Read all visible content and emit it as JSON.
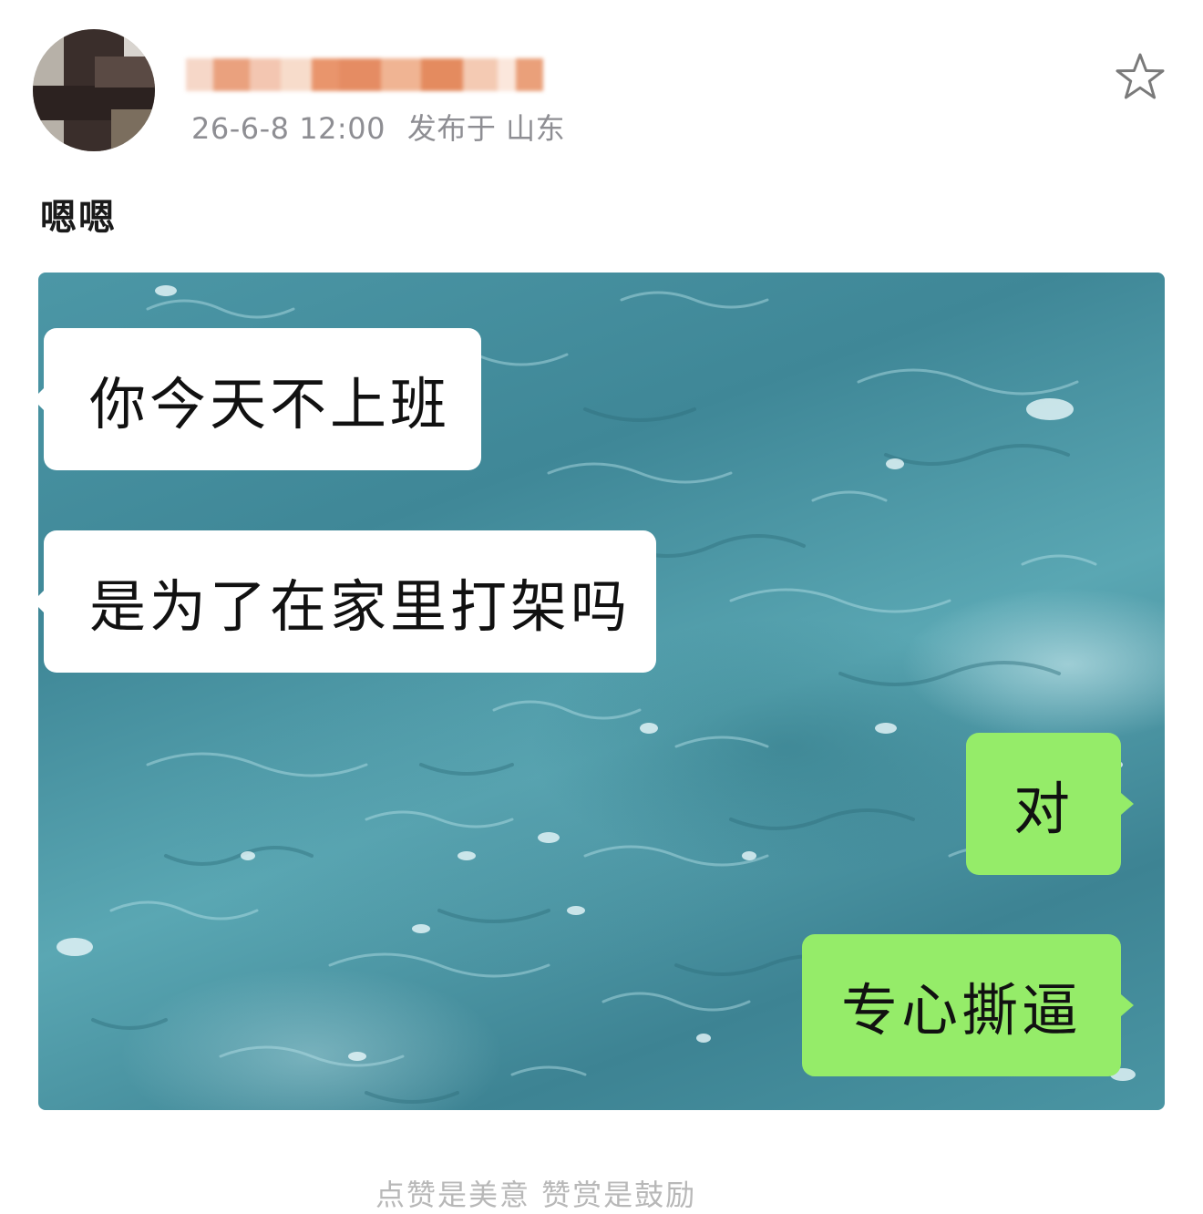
{
  "header": {
    "timestamp": "26-6-8 12:00",
    "location": "发布于 山东",
    "favorite_icon": "star-outline-icon"
  },
  "post": {
    "text": "嗯嗯"
  },
  "chat": {
    "messages": [
      {
        "side": "left",
        "text": "你今天不上班"
      },
      {
        "side": "left",
        "text": "是为了在家里打架吗"
      },
      {
        "side": "right",
        "text": "对"
      },
      {
        "side": "right",
        "text": "专心撕逼"
      }
    ]
  },
  "colors": {
    "received_bubble": "#ffffff",
    "sent_bubble": "#95ec69",
    "meta_text": "#8e8e93",
    "background": "#ffffff"
  },
  "footer": {
    "caption": "点赞是美意 赞赏是鼓励"
  }
}
